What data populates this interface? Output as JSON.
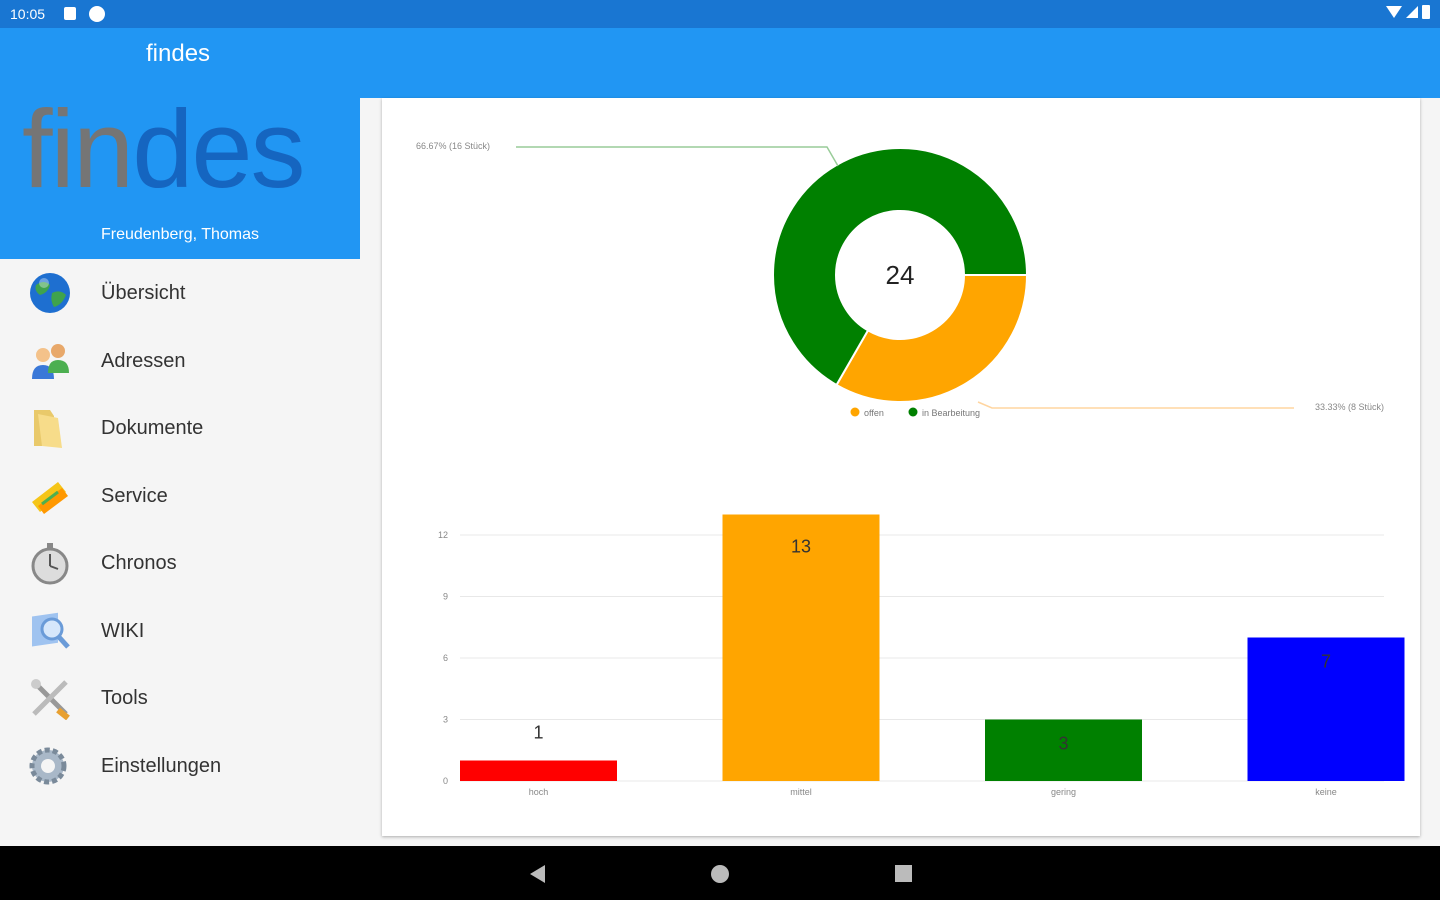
{
  "status_bar": {
    "time": "10:05"
  },
  "app_bar": {
    "title": "findes"
  },
  "drawer": {
    "logo_text_part1": "fin",
    "logo_text_part2": "des",
    "user_name": "Freudenberg, Thomas",
    "items": [
      {
        "label": "Übersicht",
        "icon": "globe-icon"
      },
      {
        "label": "Adressen",
        "icon": "people-icon"
      },
      {
        "label": "Dokumente",
        "icon": "folder-icon"
      },
      {
        "label": "Service",
        "icon": "tickets-icon"
      },
      {
        "label": "Chronos",
        "icon": "stopwatch-icon"
      },
      {
        "label": "WIKI",
        "icon": "wiki-search-icon"
      },
      {
        "label": "Tools",
        "icon": "tools-icon"
      },
      {
        "label": "Einstellungen",
        "icon": "gear-icon"
      }
    ]
  },
  "colors": {
    "appbar": "#2196f3",
    "statusbar": "#1976d2",
    "orange": "#ffa500",
    "green": "#008000",
    "red": "#ff0000",
    "blue": "#0000ff"
  },
  "chart_data": [
    {
      "type": "pie",
      "variant": "donut",
      "center_label": "24",
      "slices": [
        {
          "name": "offen",
          "value": 8,
          "label": "33.33% (8 Stück)",
          "color": "#ffa500"
        },
        {
          "name": "in Bearbeitung",
          "value": 16,
          "label": "66.67% (16 Stück)",
          "color": "#008000"
        }
      ],
      "legend": [
        "offen",
        "in Bearbeitung"
      ],
      "legend_position": "bottom"
    },
    {
      "type": "bar",
      "categories": [
        "hoch",
        "mittel",
        "gering",
        "keine"
      ],
      "values": [
        1,
        13,
        3,
        7
      ],
      "colors": [
        "#ff0000",
        "#ffa500",
        "#008000",
        "#0000ff"
      ],
      "y_ticks": [
        0,
        3,
        6,
        9,
        12
      ],
      "ylim": [
        0,
        13
      ],
      "grid": true
    }
  ]
}
